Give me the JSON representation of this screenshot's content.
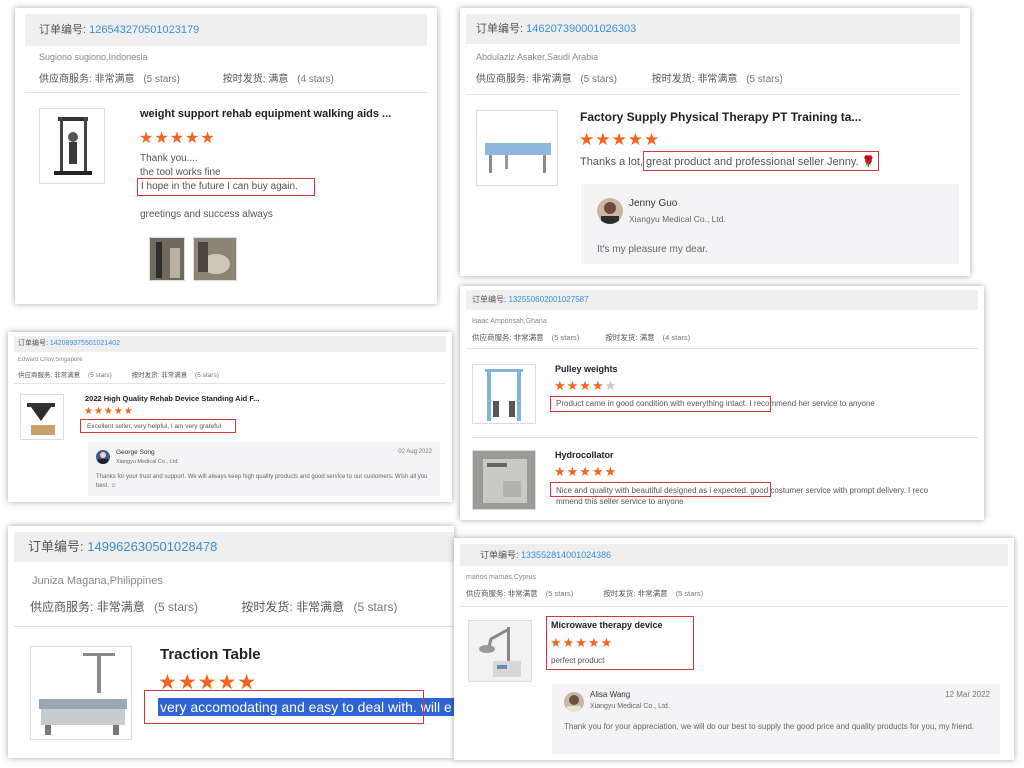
{
  "reviews": {
    "r1": {
      "order_label": "订单编号:",
      "order_number": "1265432705010231​79",
      "buyer": "Sugiono sugiono,Indonesia",
      "service_label": "供应商服务:",
      "service_value": "非常满意",
      "service_stars": "(5 stars)",
      "delivery_label": "按时发货:",
      "delivery_value": "满意",
      "delivery_stars": "(4 stars)",
      "product_title": "weight support rehab equipment walking aids ...",
      "stars": "★★★★★",
      "line1": "Thank you....",
      "line2": "the tool works fine",
      "line3": "I hope in the future I can buy again.",
      "line4": "greetings and success always"
    },
    "r2": {
      "order_label": "订单编号:",
      "order_number": "146207390001026303",
      "buyer": "Abdulaziz Asaker,Saudi Arabia",
      "service_label": "供应商服务:",
      "service_value": "非常满意",
      "service_stars": "(5 stars)",
      "delivery_label": "按时发货:",
      "delivery_value": "非常满意",
      "delivery_stars": "(5 stars)",
      "product_title": "Factory Supply Physical Therapy PT Training ta...",
      "stars": "★★★★★",
      "text_a": "Thanks a lot,",
      "text_b": "great product and professional seller Jenny.",
      "flower": "🌹",
      "reply_name": "Jenny Guo",
      "reply_company": "Xiangyu Medical Co., Ltd.",
      "reply_text": "It's my pleasure my dear."
    },
    "r3": {
      "order_label": "订单编号:",
      "order_number": "142089375501021402",
      "buyer": "Edward Chov,Singapore",
      "service_label": "供应商服务:",
      "service_value": "非常满意",
      "service_stars": "(5 stars)",
      "delivery_label": "按时发货:",
      "delivery_value": "非常满意",
      "delivery_stars": "(5 stars)",
      "product_title": "2022 High Quality Rehab Device Standing Aid F...",
      "stars": "★★★★★",
      "text": "Excellent seller, very helpful, I am very grateful",
      "reply_name": "George Song",
      "reply_company": "Xiangyu Medical Co., Ltd.",
      "reply_date": "02 Aug 2022",
      "reply_text": "Thanks for your trust and support. We will always keep high quality products and good service to our customers. Wish all you best. ☺"
    },
    "r4": {
      "order_label": "订单编号:",
      "order_number": "132550602001027587",
      "buyer": "Isaac Amponsah,Ghana",
      "service_label": "供应商服务:",
      "service_value": "非常满意",
      "service_stars": "(5 stars)",
      "delivery_label": "按时发货:",
      "delivery_value": "满意",
      "delivery_stars": "(4 stars)",
      "item1_title": "Pulley weights",
      "item1_stars": "★★★★",
      "item1_star_off": "★",
      "item1_text_a": "Product came in good condition with everything intact.",
      "item1_text_b": "I recommend her service to anyone",
      "item2_title": "Hydrocollator",
      "item2_stars": "★★★★★",
      "item2_text_a": "Nice and quality with beautiful designed as i expected.",
      "item2_text_b": "good costumer service with prompt delivery. I reco",
      "item2_text_c": "mmend this seller service to anyone"
    },
    "r5": {
      "order_label": "订单编号:",
      "order_number": "149962630501028478",
      "buyer": "Juniza Magana,Philippines",
      "service_label": "供应商服务:",
      "service_value": "非常满意",
      "service_stars": "(5 stars)",
      "delivery_label": "按时发货:",
      "delivery_value": "非常满意",
      "delivery_stars": "(5 stars)",
      "product_title": "Traction Table",
      "stars": "★★★★★",
      "text": "very accomodating and easy to deal with. will e"
    },
    "r6": {
      "order_label": "订单编号:",
      "order_number": "133552814001024386",
      "buyer": "marios mamas,Cyprus",
      "service_label": "供应商服务:",
      "service_value": "非常满意",
      "service_stars": "(5 stars)",
      "delivery_label": "按时发货:",
      "delivery_value": "非常满意",
      "delivery_stars": "(5 stars)",
      "product_title": "Microwave therapy device",
      "stars": "★★★★★",
      "text": "perfect product",
      "reply_name": "Alisa Wang",
      "reply_company": "Xiangyu Medical Co., Ltd.",
      "reply_date": "12 Mar 2022",
      "reply_text": "Thank you for your appreciation, we will do our best to supply the good price and quality products for you, my friend."
    }
  },
  "colors": {
    "star": "#f4641c",
    "order_number": "#3a8ed8",
    "highlight": "#d9353a",
    "selection": "#2f64d6"
  }
}
